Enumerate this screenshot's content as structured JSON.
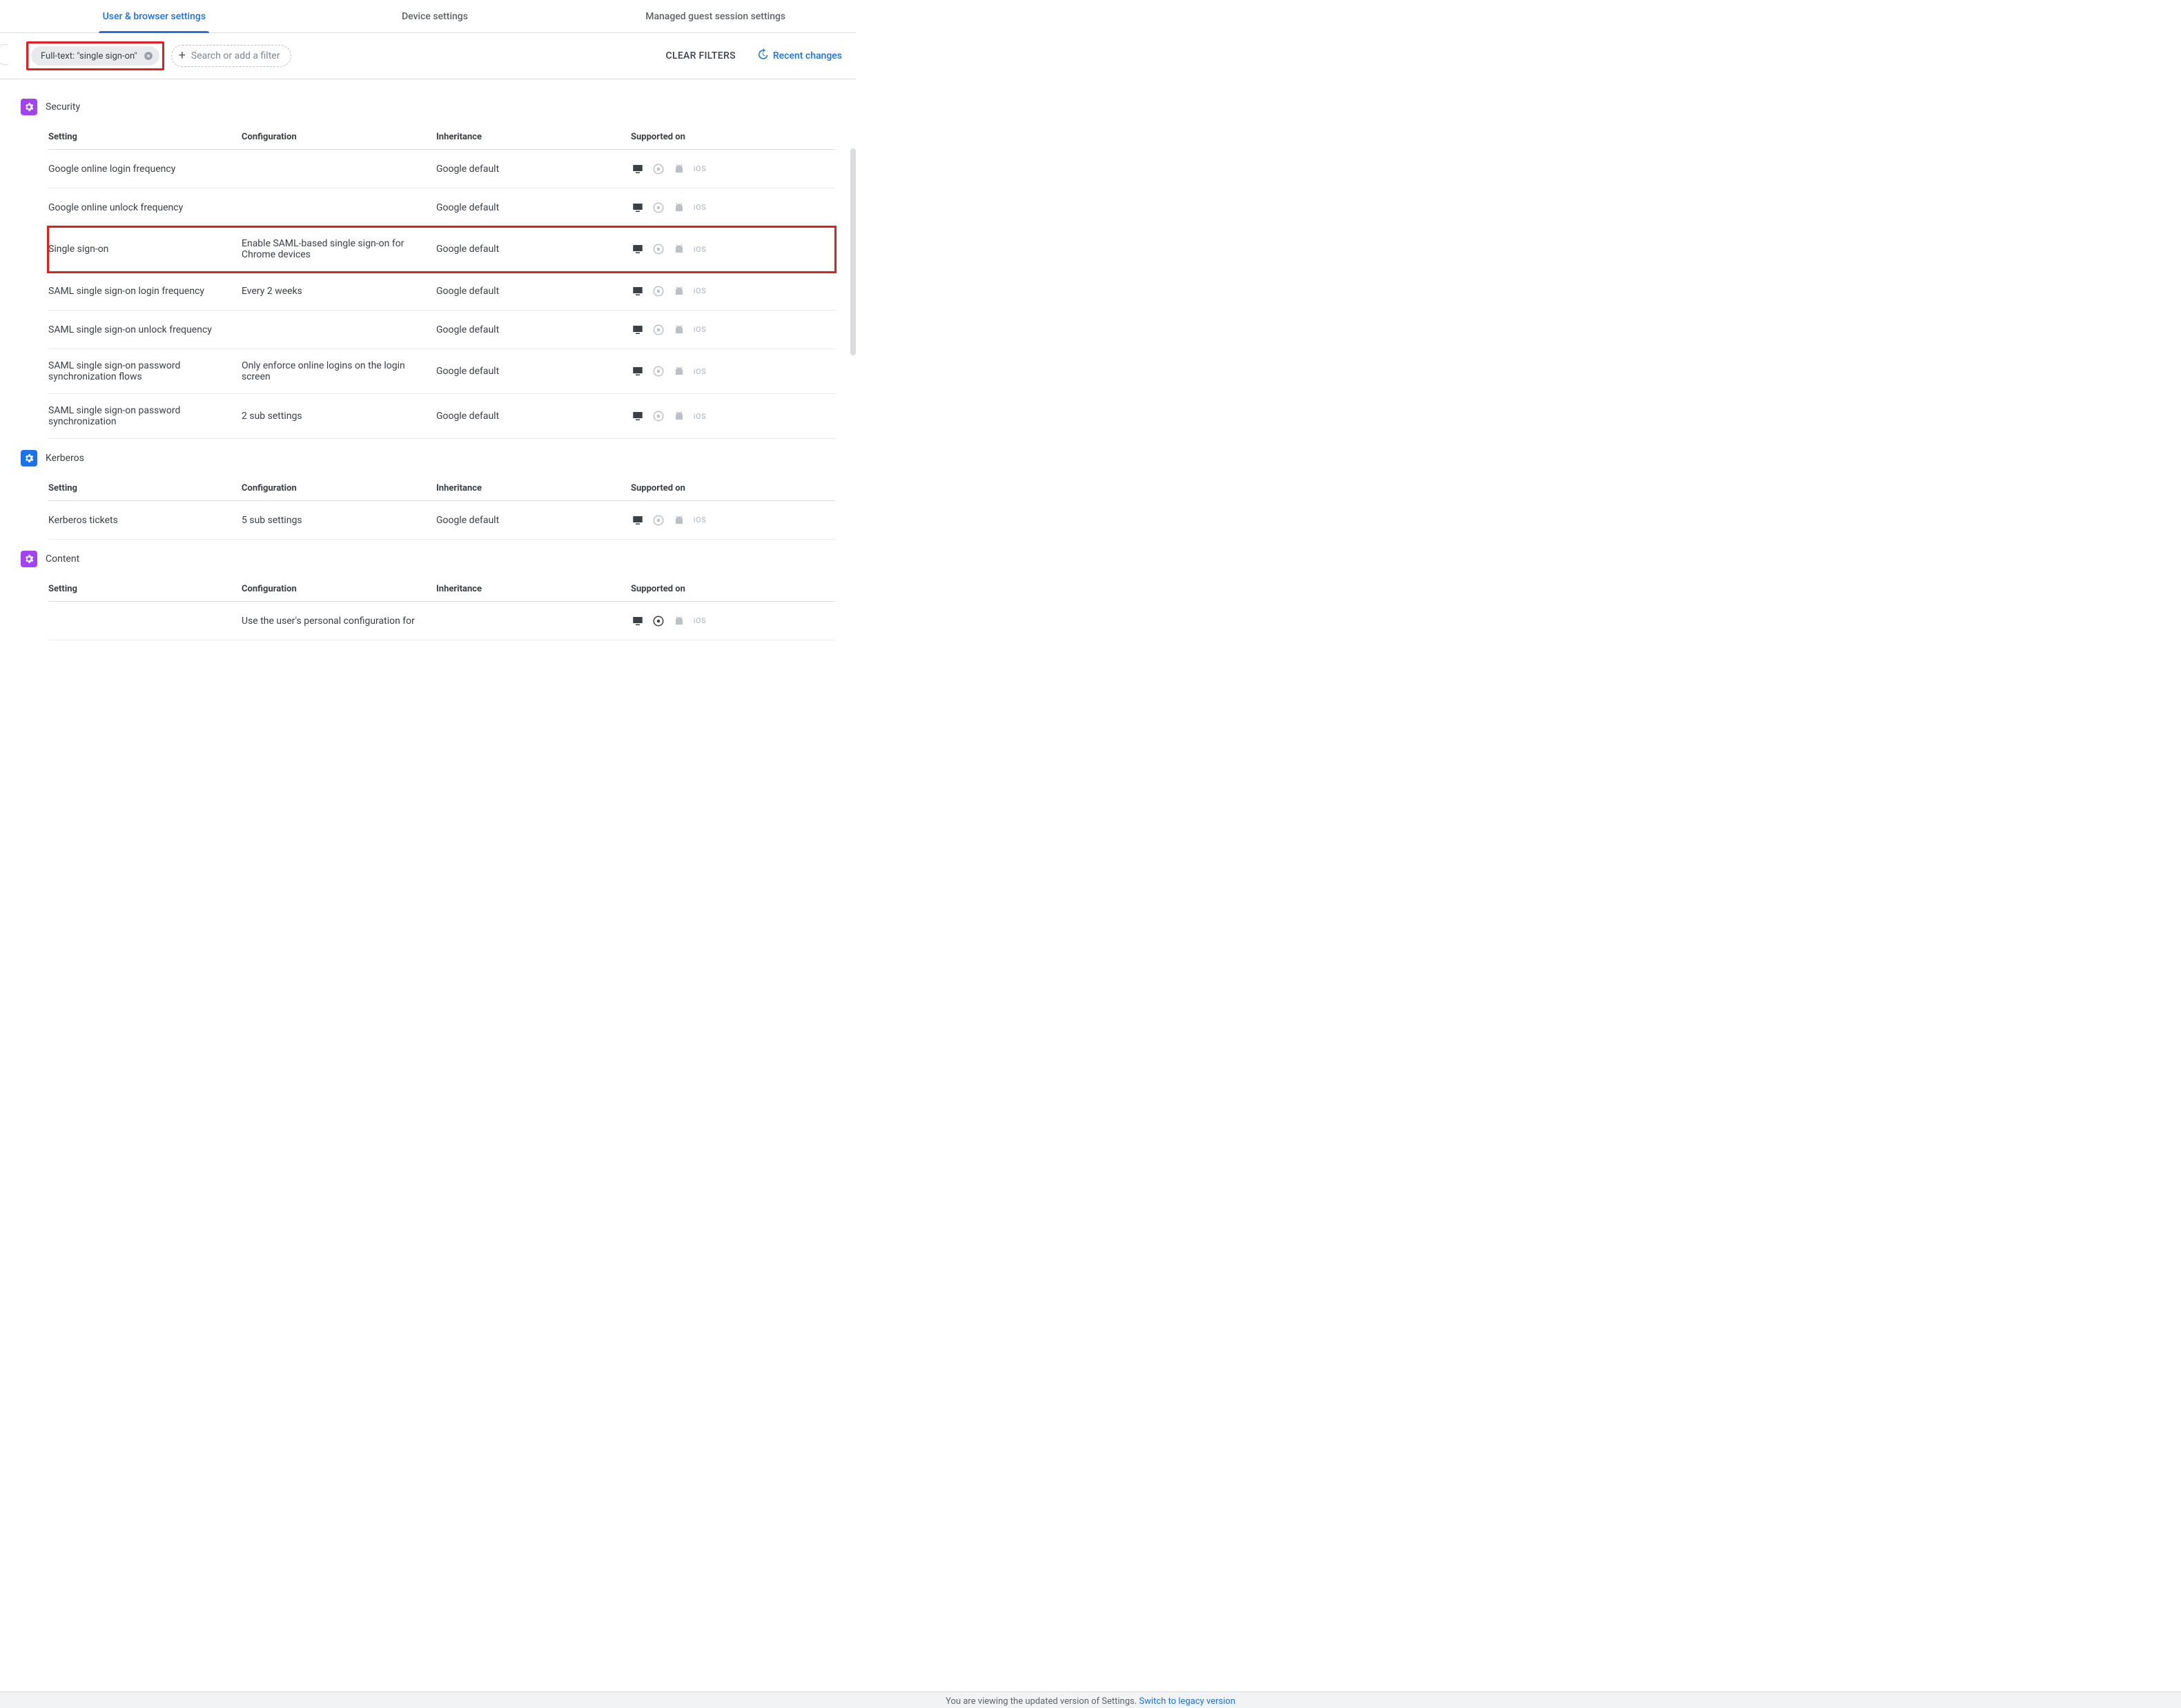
{
  "tabs": [
    {
      "label": "User & browser settings",
      "active": true
    },
    {
      "label": "Device settings",
      "active": false
    },
    {
      "label": "Managed guest session settings",
      "active": false
    }
  ],
  "filter": {
    "chip_label": "Full-text: \"single sign-on\"",
    "add_placeholder": "Search or add a filter",
    "clear_label": "Clear filters",
    "recent_label": "Recent changes"
  },
  "columns": {
    "setting": "Setting",
    "configuration": "Configuration",
    "inheritance": "Inheritance",
    "supported": "Supported on"
  },
  "sections": [
    {
      "title": "Security",
      "icon": "gear-icon",
      "color": "sec-purple",
      "rows": [
        {
          "setting": "Google online login frequency",
          "configuration": "",
          "inheritance": "Google default",
          "platforms": {
            "desktop": true,
            "chrome": false,
            "android": false,
            "ios": false
          },
          "highlighted": false
        },
        {
          "setting": "Google online unlock frequency",
          "configuration": "",
          "inheritance": "Google default",
          "platforms": {
            "desktop": true,
            "chrome": false,
            "android": false,
            "ios": false
          },
          "highlighted": false
        },
        {
          "setting": "Single sign-on",
          "configuration": "Enable SAML-based single sign-on for Chrome devices",
          "inheritance": "Google default",
          "platforms": {
            "desktop": true,
            "chrome": false,
            "android": false,
            "ios": false
          },
          "highlighted": true
        },
        {
          "setting": "SAML single sign-on login frequency",
          "configuration": "Every 2 weeks",
          "inheritance": "Google default",
          "platforms": {
            "desktop": true,
            "chrome": false,
            "android": false,
            "ios": false
          },
          "highlighted": false
        },
        {
          "setting": "SAML single sign-on unlock frequency",
          "configuration": "",
          "inheritance": "Google default",
          "platforms": {
            "desktop": true,
            "chrome": false,
            "android": false,
            "ios": false
          },
          "highlighted": false
        },
        {
          "setting": "SAML single sign-on password synchronization flows",
          "configuration": "Only enforce online logins on the login screen",
          "inheritance": "Google default",
          "platforms": {
            "desktop": true,
            "chrome": false,
            "android": false,
            "ios": false
          },
          "highlighted": false
        },
        {
          "setting": "SAML single sign-on password synchronization",
          "configuration": "2 sub settings",
          "inheritance": "Google default",
          "platforms": {
            "desktop": true,
            "chrome": false,
            "android": false,
            "ios": false
          },
          "highlighted": false
        }
      ]
    },
    {
      "title": "Kerberos",
      "icon": "gear-icon",
      "color": "sec-blue",
      "rows": [
        {
          "setting": "Kerberos tickets",
          "configuration": "5 sub settings",
          "inheritance": "Google default",
          "platforms": {
            "desktop": true,
            "chrome": false,
            "android": false,
            "ios": false
          },
          "highlighted": false
        }
      ]
    },
    {
      "title": "Content",
      "icon": "gear-icon",
      "color": "sec-purple",
      "rows": [
        {
          "setting": "",
          "configuration": "Use the user's personal configuration for",
          "inheritance": "",
          "platforms": {
            "desktop": true,
            "chrome": true,
            "android": false,
            "ios": false
          },
          "highlighted": false,
          "partial": true
        }
      ]
    }
  ],
  "footer": {
    "text": "You are viewing the updated version of Settings.",
    "link": "Switch to legacy version"
  },
  "ios_label": "iOS"
}
